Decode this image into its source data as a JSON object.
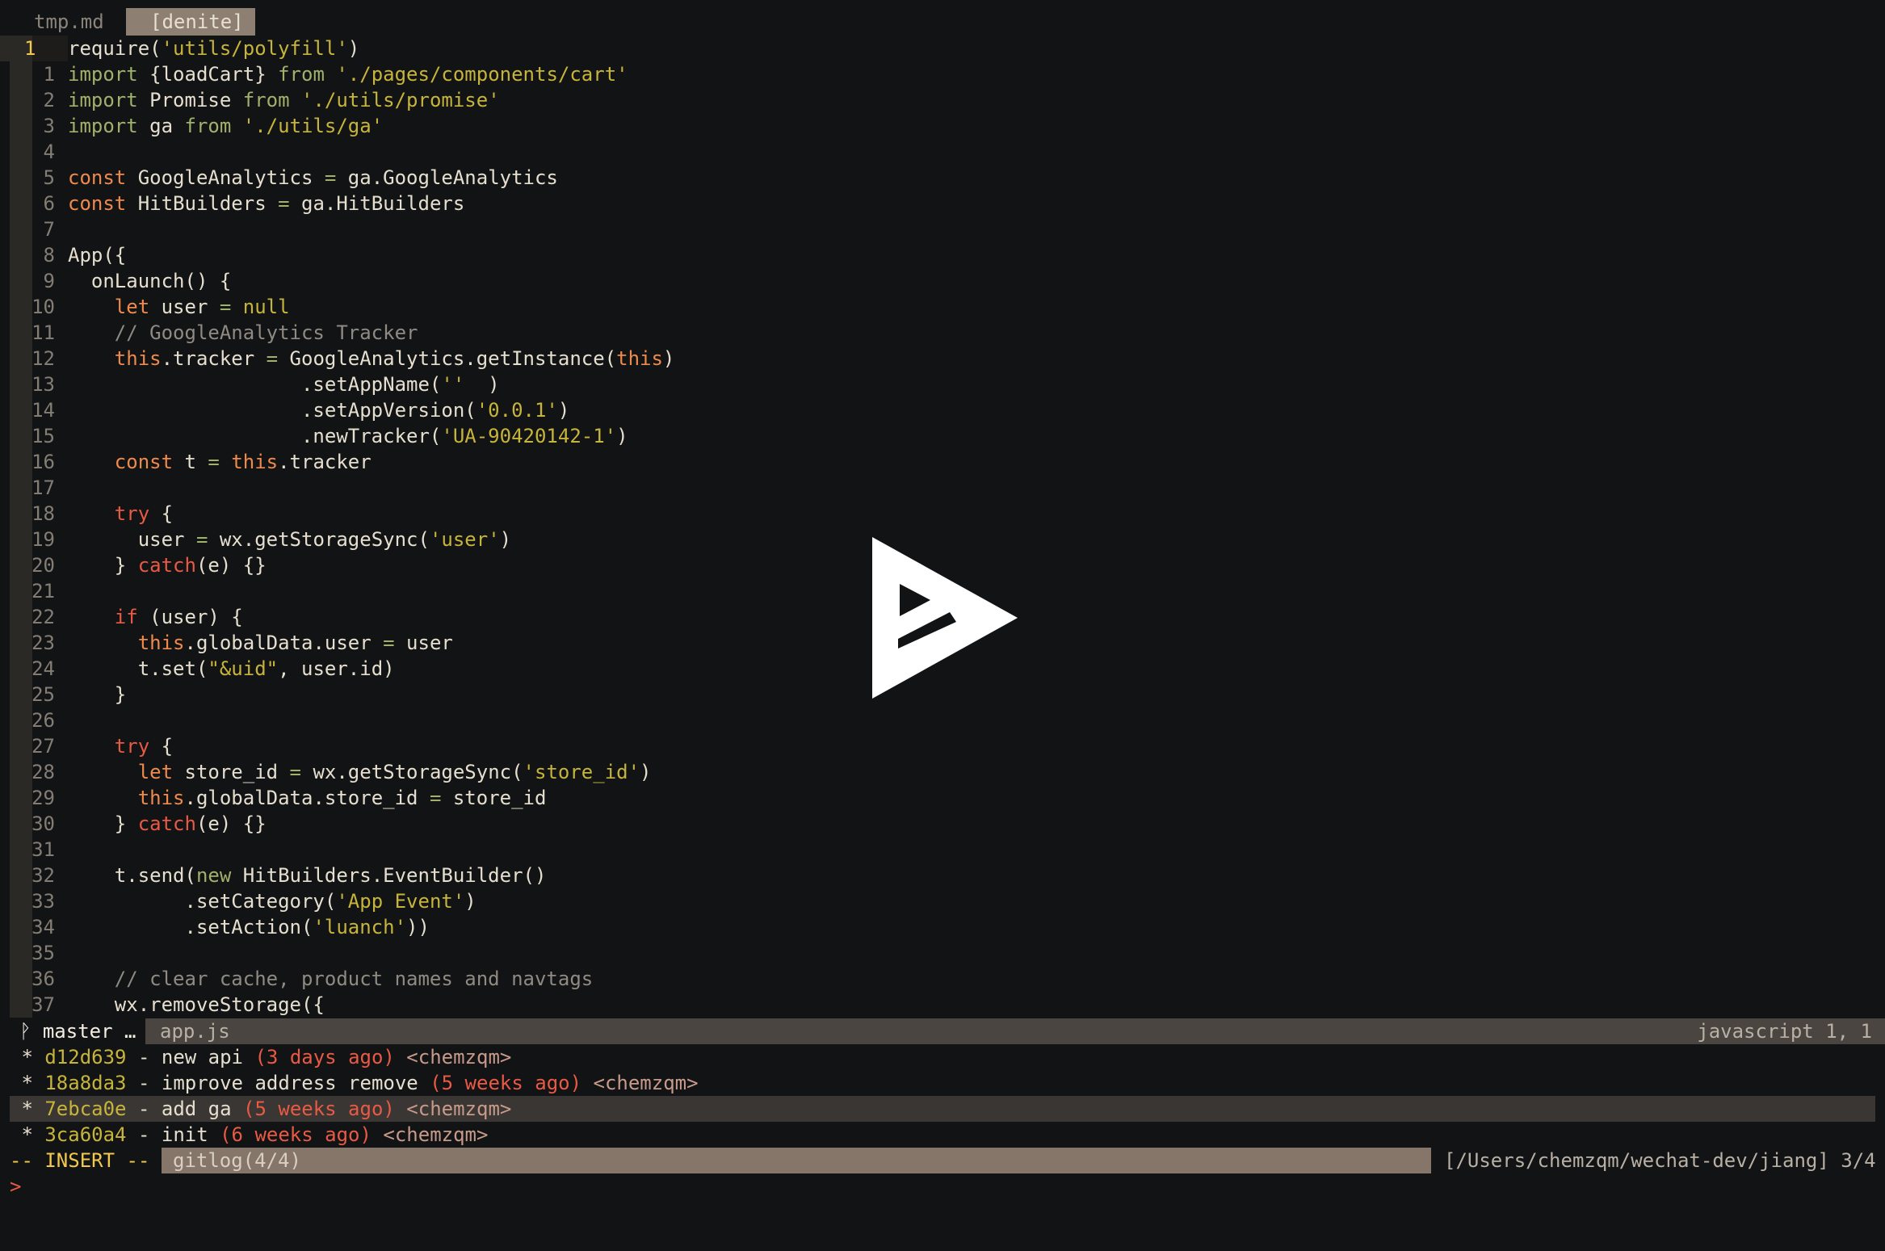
{
  "tabs": [
    "tmp.md",
    "[denite]"
  ],
  "current_line": "1",
  "code_lines": [
    {
      "n": "1",
      "segs": [
        [
          "tx",
          "require("
        ],
        [
          "str",
          "'utils/polyfill'"
        ],
        [
          "tx",
          ")"
        ]
      ],
      "cur": true
    },
    {
      "n": "1",
      "segs": [
        [
          "gr",
          "import "
        ],
        [
          "tx",
          "{loadCart} "
        ],
        [
          "gr",
          "from "
        ],
        [
          "str",
          "'./pages/components/cart'"
        ]
      ]
    },
    {
      "n": "2",
      "segs": [
        [
          "gr",
          "import "
        ],
        [
          "tx",
          "Promise "
        ],
        [
          "gr",
          "from "
        ],
        [
          "str",
          "'./utils/promise'"
        ]
      ]
    },
    {
      "n": "3",
      "segs": [
        [
          "gr",
          "import "
        ],
        [
          "tx",
          "ga "
        ],
        [
          "gr",
          "from "
        ],
        [
          "str",
          "'./utils/ga'"
        ]
      ]
    },
    {
      "n": "4",
      "segs": []
    },
    {
      "n": "5",
      "segs": [
        [
          "kw",
          "const "
        ],
        [
          "tx",
          "GoogleAnalytics "
        ],
        [
          "gr",
          "= "
        ],
        [
          "tx",
          "ga.GoogleAnalytics"
        ]
      ]
    },
    {
      "n": "6",
      "segs": [
        [
          "kw",
          "const "
        ],
        [
          "tx",
          "HitBuilders "
        ],
        [
          "gr",
          "= "
        ],
        [
          "tx",
          "ga.HitBuilders"
        ]
      ]
    },
    {
      "n": "7",
      "segs": []
    },
    {
      "n": "8",
      "segs": [
        [
          "tx",
          "App({"
        ]
      ]
    },
    {
      "n": "9",
      "segs": [
        [
          "tx",
          "  onLaunch() {"
        ]
      ]
    },
    {
      "n": "10",
      "segs": [
        [
          "tx",
          "    "
        ],
        [
          "kw",
          "let "
        ],
        [
          "tx",
          "user "
        ],
        [
          "gr",
          "= "
        ],
        [
          "str",
          "null"
        ]
      ]
    },
    {
      "n": "11",
      "segs": [
        [
          "cm",
          "    // GoogleAnalytics Tracker"
        ]
      ]
    },
    {
      "n": "12",
      "segs": [
        [
          "tx",
          "    "
        ],
        [
          "kw",
          "this"
        ],
        [
          "tx",
          ".tracker "
        ],
        [
          "gr",
          "= "
        ],
        [
          "tx",
          "GoogleAnalytics.getInstance("
        ],
        [
          "kw",
          "this"
        ],
        [
          "tx",
          ")"
        ]
      ]
    },
    {
      "n": "13",
      "segs": [
        [
          "tx",
          "                    .setAppName("
        ],
        [
          "str",
          "''"
        ],
        [
          "tx",
          "  )"
        ]
      ]
    },
    {
      "n": "14",
      "segs": [
        [
          "tx",
          "                    .setAppVersion("
        ],
        [
          "str",
          "'0.0.1'"
        ],
        [
          "tx",
          ")"
        ]
      ]
    },
    {
      "n": "15",
      "segs": [
        [
          "tx",
          "                    .newTracker("
        ],
        [
          "str",
          "'UA-90420142-1'"
        ],
        [
          "tx",
          ")"
        ]
      ]
    },
    {
      "n": "16",
      "segs": [
        [
          "tx",
          "    "
        ],
        [
          "kw",
          "const "
        ],
        [
          "tx",
          "t "
        ],
        [
          "gr",
          "= "
        ],
        [
          "kw",
          "this"
        ],
        [
          "tx",
          ".tracker"
        ]
      ]
    },
    {
      "n": "17",
      "segs": []
    },
    {
      "n": "18",
      "segs": [
        [
          "tx",
          "    "
        ],
        [
          "kw2",
          "try "
        ],
        [
          "tx",
          "{"
        ]
      ]
    },
    {
      "n": "19",
      "segs": [
        [
          "tx",
          "      user "
        ],
        [
          "gr",
          "= "
        ],
        [
          "tx",
          "wx.getStorageSync("
        ],
        [
          "str",
          "'user'"
        ],
        [
          "tx",
          ")"
        ]
      ]
    },
    {
      "n": "20",
      "segs": [
        [
          "tx",
          "    } "
        ],
        [
          "kw2",
          "catch"
        ],
        [
          "tx",
          "(e) {}"
        ]
      ]
    },
    {
      "n": "21",
      "segs": []
    },
    {
      "n": "22",
      "segs": [
        [
          "tx",
          "    "
        ],
        [
          "kw2",
          "if "
        ],
        [
          "tx",
          "(user) {"
        ]
      ]
    },
    {
      "n": "23",
      "segs": [
        [
          "tx",
          "      "
        ],
        [
          "kw",
          "this"
        ],
        [
          "tx",
          ".globalData.user "
        ],
        [
          "gr",
          "= "
        ],
        [
          "tx",
          "user"
        ]
      ]
    },
    {
      "n": "24",
      "segs": [
        [
          "tx",
          "      t.set("
        ],
        [
          "str",
          "\"&uid\""
        ],
        [
          "tx",
          ", user.id)"
        ]
      ]
    },
    {
      "n": "25",
      "segs": [
        [
          "tx",
          "    }"
        ]
      ]
    },
    {
      "n": "26",
      "segs": []
    },
    {
      "n": "27",
      "segs": [
        [
          "tx",
          "    "
        ],
        [
          "kw2",
          "try "
        ],
        [
          "tx",
          "{"
        ]
      ]
    },
    {
      "n": "28",
      "segs": [
        [
          "tx",
          "      "
        ],
        [
          "kw",
          "let "
        ],
        [
          "tx",
          "store_id "
        ],
        [
          "gr",
          "= "
        ],
        [
          "tx",
          "wx.getStorageSync("
        ],
        [
          "str",
          "'store_id'"
        ],
        [
          "tx",
          ")"
        ]
      ]
    },
    {
      "n": "29",
      "segs": [
        [
          "tx",
          "      "
        ],
        [
          "kw",
          "this"
        ],
        [
          "tx",
          ".globalData.store_id "
        ],
        [
          "gr",
          "= "
        ],
        [
          "tx",
          "store_id"
        ]
      ]
    },
    {
      "n": "30",
      "segs": [
        [
          "tx",
          "    } "
        ],
        [
          "kw2",
          "catch"
        ],
        [
          "tx",
          "(e) {}"
        ]
      ]
    },
    {
      "n": "31",
      "segs": []
    },
    {
      "n": "32",
      "segs": [
        [
          "tx",
          "    t.send("
        ],
        [
          "gr",
          "new "
        ],
        [
          "tx",
          "HitBuilders.EventBuilder()"
        ]
      ]
    },
    {
      "n": "33",
      "segs": [
        [
          "tx",
          "          .setCategory("
        ],
        [
          "str",
          "'App Event'"
        ],
        [
          "tx",
          ")"
        ]
      ]
    },
    {
      "n": "34",
      "segs": [
        [
          "tx",
          "          .setAction("
        ],
        [
          "str",
          "'luanch'"
        ],
        [
          "tx",
          "))"
        ]
      ]
    },
    {
      "n": "35",
      "segs": []
    },
    {
      "n": "36",
      "segs": [
        [
          "cm",
          "    // clear cache, product names and navtags"
        ]
      ]
    },
    {
      "n": "37",
      "segs": [
        [
          "tx",
          "    wx.removeStorage({"
        ]
      ]
    }
  ],
  "statusline": {
    "branch": "ᚹ master …",
    "file": "app.js",
    "filetype": "javascript 1, 1"
  },
  "gitlog": [
    {
      "hash": "d12d639",
      "msg": " - new api ",
      "ago": "(3 days ago)",
      "author": " <chemzqm>"
    },
    {
      "hash": "18a8da3",
      "msg": " - improve address remove ",
      "ago": "(5 weeks ago)",
      "author": " <chemzqm>"
    },
    {
      "hash": "7ebca0e",
      "msg": " - add ga ",
      "ago": "(5 weeks ago)",
      "author": " <chemzqm>",
      "selected": true
    },
    {
      "hash": "3ca60a4",
      "msg": " - init ",
      "ago": "(6 weeks ago)",
      "author": " <chemzqm>"
    }
  ],
  "modeline": {
    "mode": "-- INSERT --",
    "buffer": "gitlog(4/4)",
    "path": "[/Users/chemzqm/wechat-dev/jiang] 3/4"
  },
  "prompt": ">"
}
